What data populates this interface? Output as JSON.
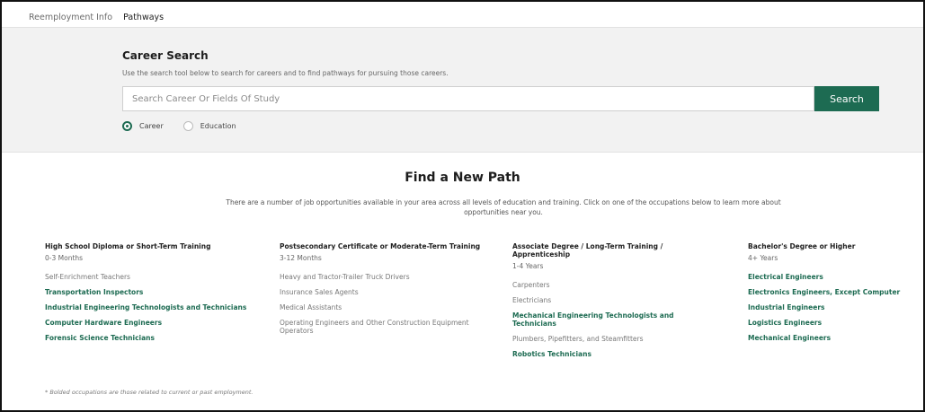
{
  "tabs": [
    {
      "label": "Reemployment Info",
      "active": false
    },
    {
      "label": "Pathways",
      "active": true
    }
  ],
  "career_search": {
    "title": "Career Search",
    "description": "Use the search tool below to search for careers and to find pathways for pursuing those careers.",
    "placeholder": "Search Career Or Fields Of Study",
    "button_label": "Search",
    "radio_options": [
      {
        "label": "Career",
        "checked": true
      },
      {
        "label": "Education",
        "checked": false
      }
    ]
  },
  "find_path": {
    "title": "Find a New Path",
    "description": "There are a number of job opportunities available in your area across all levels of education and training. Click on one of the occupations below to learn more about opportunities near you."
  },
  "columns": [
    {
      "heading": "High School Diploma or Short-Term Training",
      "duration": "0-3 Months",
      "occupations": [
        {
          "label": "Self-Enrichment Teachers",
          "bold": false
        },
        {
          "label": "Transportation Inspectors",
          "bold": true
        },
        {
          "label": "Industrial Engineering Technologists and Technicians",
          "bold": true
        },
        {
          "label": "Computer Hardware Engineers",
          "bold": true
        },
        {
          "label": "Forensic Science Technicians",
          "bold": true
        }
      ]
    },
    {
      "heading": "Postsecondary Certificate or Moderate-Term Training",
      "duration": "3-12 Months",
      "occupations": [
        {
          "label": "Heavy and Tractor-Trailer Truck Drivers",
          "bold": false
        },
        {
          "label": "Insurance Sales Agents",
          "bold": false
        },
        {
          "label": "Medical Assistants",
          "bold": false
        },
        {
          "label": "Operating Engineers and Other Construction Equipment Operators",
          "bold": false
        }
      ]
    },
    {
      "heading": "Associate Degree / Long-Term Training / Apprenticeship",
      "duration": "1-4 Years",
      "occupations": [
        {
          "label": "Carpenters",
          "bold": false
        },
        {
          "label": "Electricians",
          "bold": false
        },
        {
          "label": "Mechanical Engineering Technologists and Technicians",
          "bold": true
        },
        {
          "label": "Plumbers, Pipefitters, and Steamfitters",
          "bold": false
        },
        {
          "label": "Robotics Technicians",
          "bold": true
        }
      ]
    },
    {
      "heading": "Bachelor's Degree or Higher",
      "duration": "4+ Years",
      "occupations": [
        {
          "label": "Electrical Engineers",
          "bold": true
        },
        {
          "label": "Electronics Engineers, Except Computer",
          "bold": true
        },
        {
          "label": "Industrial Engineers",
          "bold": true
        },
        {
          "label": "Logistics Engineers",
          "bold": true
        },
        {
          "label": "Mechanical Engineers",
          "bold": true
        }
      ]
    }
  ],
  "footnote": "* Bolded occupations are those related to current or past employment.",
  "colors": {
    "accent": "#1d6b52"
  }
}
